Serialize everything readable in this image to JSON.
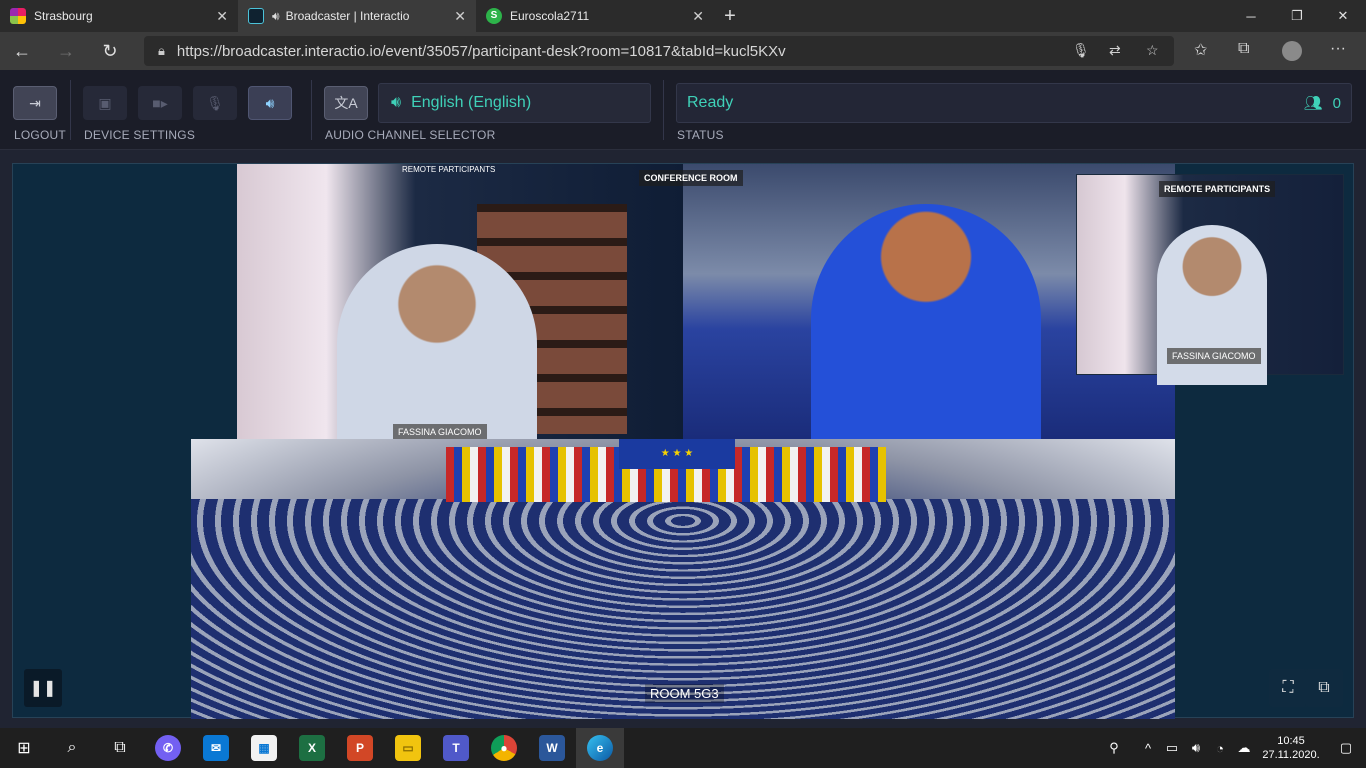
{
  "browser": {
    "tabs": [
      {
        "label": "Strasbourg",
        "icon": "colorful-squares-icon"
      },
      {
        "label": "Broadcaster | Interactio",
        "icon": "interactio-icon"
      },
      {
        "label": "Euroscola2711",
        "icon": "green-s-icon"
      }
    ],
    "new_tab": "+",
    "url": "https://broadcaster.interactio.io/event/35057/participant-desk?room=10817&tabId=kucl5KXv"
  },
  "toolbar": {
    "logout_label": "LOGOUT",
    "device_settings_label": "DEVICE SETTINGS",
    "audio_channel_label": "AUDIO CHANNEL SELECTOR",
    "channel_value": "English (English)",
    "status_label": "STATUS",
    "status_value": "Ready",
    "participant_count": "0"
  },
  "stage": {
    "remote_participants_label": "REMOTE PARTICIPANTS",
    "conference_room_label": "CONFERENCE ROOM",
    "remote_participants_pip_label": "REMOTE PARTICIPANTS",
    "participant_name": "FASSINA GIACOMO",
    "participant_name_pip": "FASSINA GIACOMO",
    "room_label": "ROOM 5G3"
  },
  "taskbar": {
    "apps": [
      "start-icon",
      "search-icon",
      "task-view-icon",
      "viber-icon",
      "mail-icon",
      "store-icon",
      "excel-icon",
      "powerpoint-icon",
      "file-explorer-icon",
      "teams-icon",
      "chrome-icon",
      "word-icon",
      "edge-icon"
    ],
    "time": "10:45",
    "date": "27.11.2020."
  }
}
